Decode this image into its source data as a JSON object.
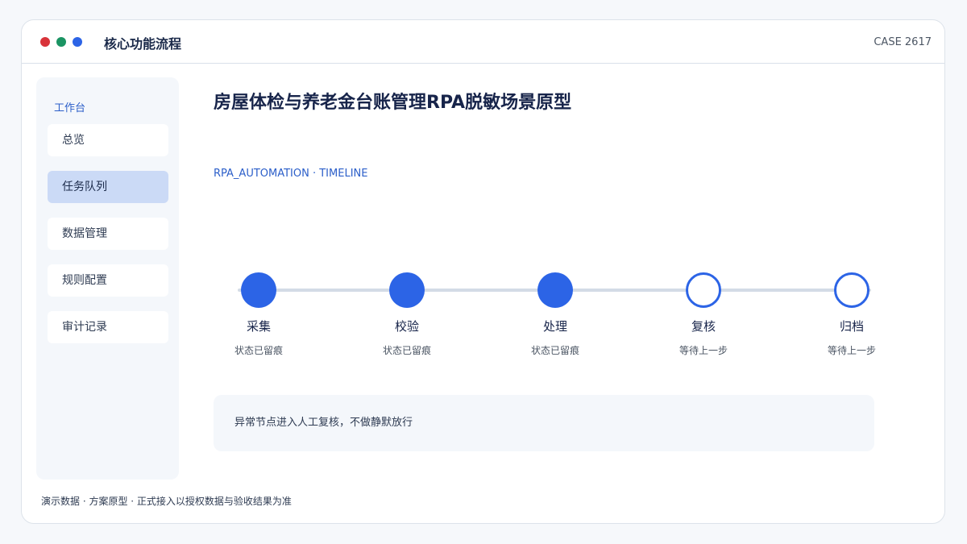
{
  "window": {
    "title": "核心功能流程",
    "case_id": "CASE 2617",
    "controls": {
      "close_color": "#d8333a",
      "minimize_color": "#1a9463",
      "maximize_color": "#2c64e6"
    }
  },
  "sidebar": {
    "heading": "工作台",
    "items": [
      {
        "label": "总览",
        "active": false
      },
      {
        "label": "任务队列",
        "active": true
      },
      {
        "label": "数据管理",
        "active": false
      },
      {
        "label": "规则配置",
        "active": false
      },
      {
        "label": "审计记录",
        "active": false
      }
    ]
  },
  "main": {
    "title": "房屋体检与养老金台账管理RPA脱敏场景原型",
    "subtitle": "RPA_AUTOMATION · TIMELINE",
    "timeline": {
      "steps": [
        {
          "label": "采集",
          "status": "状态已留痕",
          "state": "done"
        },
        {
          "label": "校验",
          "status": "状态已留痕",
          "state": "done"
        },
        {
          "label": "处理",
          "status": "状态已留痕",
          "state": "done"
        },
        {
          "label": "复核",
          "status": "等待上一步",
          "state": "pending"
        },
        {
          "label": "归档",
          "status": "等待上一步",
          "state": "pending"
        }
      ]
    },
    "notice": "异常节点进入人工复核，不做静默放行"
  },
  "footer": {
    "text": "演示数据 · 方案原型 · 正式接入以授权数据与验收结果为准"
  },
  "colors": {
    "accent": "#2c64e6",
    "active_nav_bg": "#cbdaf6",
    "panel_bg": "#f4f7fb",
    "track": "#d3dbe6"
  }
}
